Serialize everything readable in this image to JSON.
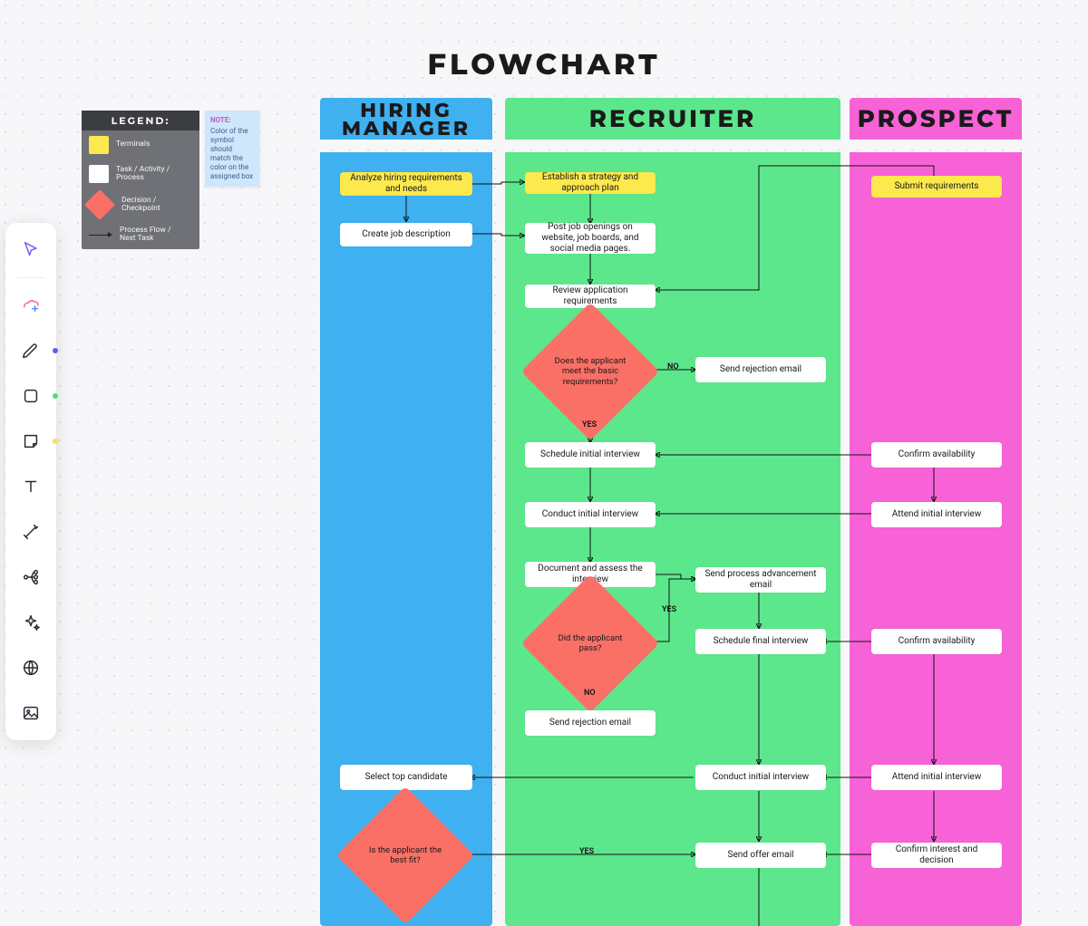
{
  "title": "FLOWCHART",
  "toolbar": {
    "tools": [
      {
        "name": "cursor-icon"
      },
      {
        "name": "ai-icon"
      },
      {
        "name": "pen-icon"
      },
      {
        "name": "shape-icon"
      },
      {
        "name": "sticky-icon"
      },
      {
        "name": "text-icon"
      },
      {
        "name": "connector-icon"
      },
      {
        "name": "mindmap-icon"
      },
      {
        "name": "sparkle-icon"
      },
      {
        "name": "web-icon"
      },
      {
        "name": "image-icon"
      }
    ]
  },
  "legend": {
    "heading": "LEGEND:",
    "items": [
      {
        "label": "Terminals",
        "swatch": "yellow"
      },
      {
        "label": "Task / Activity / Process",
        "swatch": "white"
      },
      {
        "label": "Decision / Checkpoint",
        "swatch": "diamond"
      },
      {
        "label": "Process Flow / Next Task",
        "swatch": "arrow"
      }
    ],
    "note_head": "NOTE:",
    "note_body": "Color of the symbol should match the color on the assigned box"
  },
  "lanes": {
    "hiring": "HIRING MANAGER",
    "recruiter": "RECRUITER",
    "prospect": "PROSPECT"
  },
  "nodes": {
    "hm_analyze": "Analyze hiring requirements and needs",
    "hm_jobdesc": "Create job description",
    "hm_select": "Select top candidate",
    "hm_fit": "Is the applicant the best fit?",
    "rc_strategy": "Establish a strategy and approach plan",
    "rc_post": "Post job openings on website, job boards, and social media pages.",
    "rc_review": "Review application requirements",
    "rc_qual": "Does the applicant meet the basic requirements?",
    "rc_reject1": "Send rejection email",
    "rc_sched1": "Schedule initial interview",
    "rc_conduct1": "Conduct initial interview",
    "rc_doc": "Document and assess the interview",
    "rc_pass": "Did the applicant pass?",
    "rc_advance": "Send process advancement email",
    "rc_schedfinal": "Schedule final interview",
    "rc_reject2": "Send rejection email",
    "rc_conduct2": "Conduct initial interview",
    "rc_offer": "Send offer email",
    "pr_submit": "Submit requirements",
    "pr_conf1": "Confirm availability",
    "pr_attend1": "Attend initial interview",
    "pr_conf2": "Confirm availability",
    "pr_attend2": "Attend initial interview",
    "pr_decision": "Confirm interest and decision"
  },
  "edge_labels": {
    "no1": "NO",
    "yes1": "YES",
    "yes2": "YES",
    "no2": "NO",
    "yes3": "YES"
  }
}
